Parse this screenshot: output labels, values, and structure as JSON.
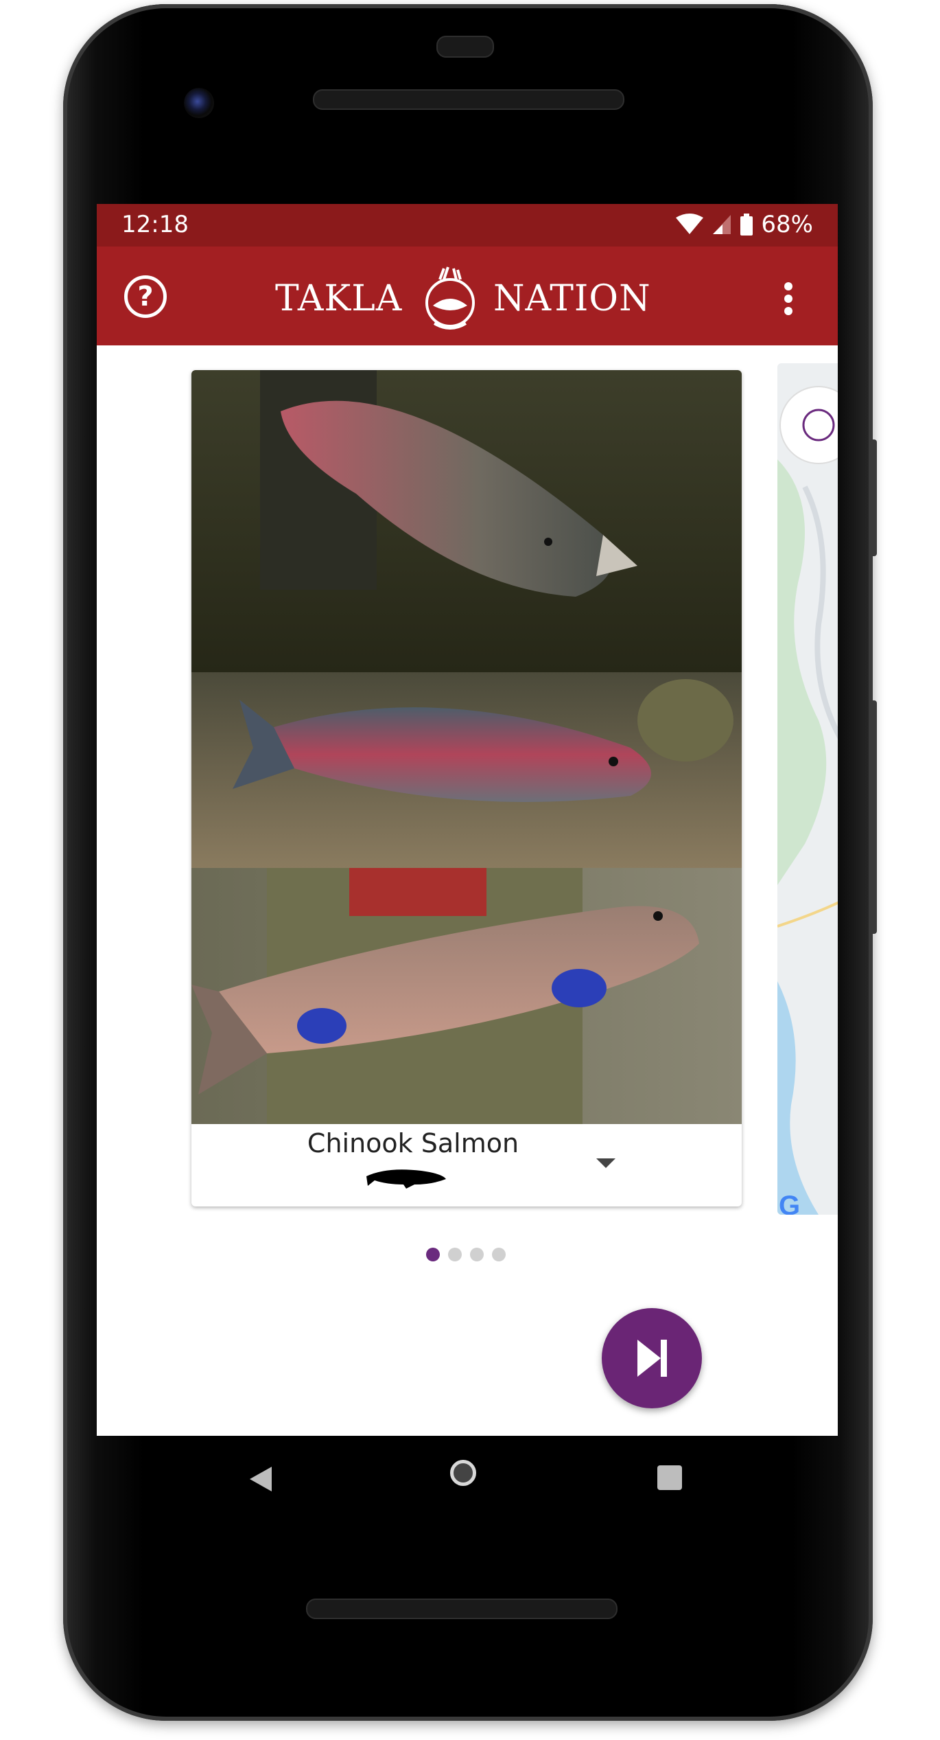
{
  "status_bar": {
    "time": "12:18",
    "battery": "68%"
  },
  "app_bar": {
    "title_left": "TAKLA",
    "title_right": "NATION",
    "help_icon": "help-circle-icon",
    "menu_icon": "more-vert-icon"
  },
  "species_card": {
    "name": "Chinook Salmon",
    "selector_icon": "chevron-down-icon"
  },
  "pager": {
    "total": 4,
    "active_index": 0
  },
  "fab": {
    "icon": "skip-next-icon"
  },
  "nav": {
    "back_icon": "back-icon",
    "home_icon": "home-icon",
    "recent_icon": "recent-apps-icon"
  },
  "colors": {
    "status_bar": "#8b1a1b",
    "app_bar": "#a31f22",
    "accent": "#6a2575"
  }
}
